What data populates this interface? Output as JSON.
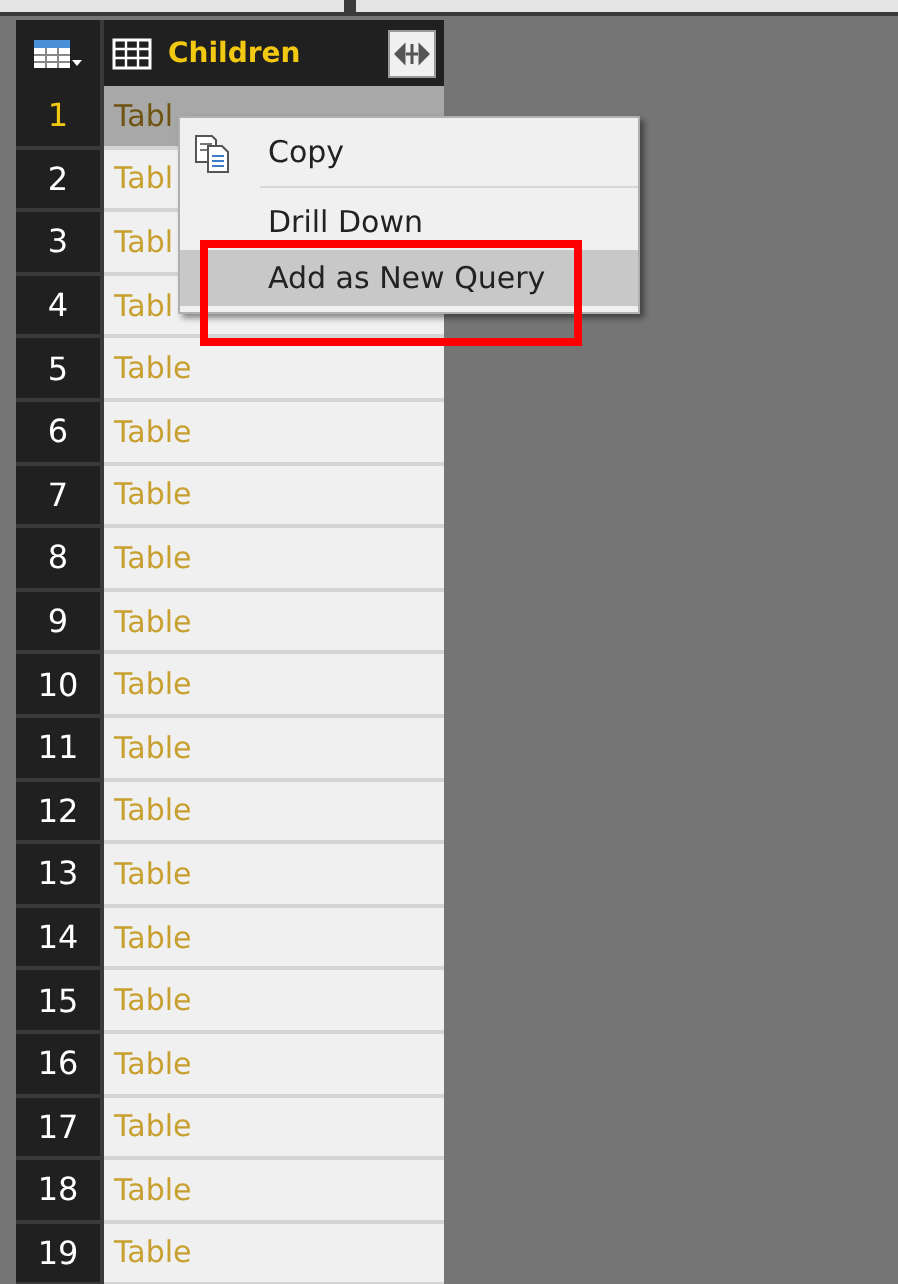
{
  "table": {
    "column": {
      "title": "Children"
    },
    "rows": [
      {
        "number": "1",
        "value": "Tabl",
        "selected": true
      },
      {
        "number": "2",
        "value": "Tabl",
        "selected": false
      },
      {
        "number": "3",
        "value": "Tabl",
        "selected": false
      },
      {
        "number": "4",
        "value": "Tabl",
        "selected": false
      },
      {
        "number": "5",
        "value": "Table",
        "selected": false
      },
      {
        "number": "6",
        "value": "Table",
        "selected": false
      },
      {
        "number": "7",
        "value": "Table",
        "selected": false
      },
      {
        "number": "8",
        "value": "Table",
        "selected": false
      },
      {
        "number": "9",
        "value": "Table",
        "selected": false
      },
      {
        "number": "10",
        "value": "Table",
        "selected": false
      },
      {
        "number": "11",
        "value": "Table",
        "selected": false
      },
      {
        "number": "12",
        "value": "Table",
        "selected": false
      },
      {
        "number": "13",
        "value": "Table",
        "selected": false
      },
      {
        "number": "14",
        "value": "Table",
        "selected": false
      },
      {
        "number": "15",
        "value": "Table",
        "selected": false
      },
      {
        "number": "16",
        "value": "Table",
        "selected": false
      },
      {
        "number": "17",
        "value": "Table",
        "selected": false
      },
      {
        "number": "18",
        "value": "Table",
        "selected": false
      },
      {
        "number": "19",
        "value": "Table",
        "selected": false
      }
    ]
  },
  "context_menu": {
    "items": [
      {
        "label": "Copy",
        "kind": "icon",
        "selected": false
      },
      {
        "label": "Drill Down",
        "kind": "plain",
        "selected": false
      },
      {
        "label": "Add as New Query",
        "kind": "plain",
        "selected": true
      }
    ],
    "highlight_box": {
      "color": "#ff0000"
    }
  }
}
